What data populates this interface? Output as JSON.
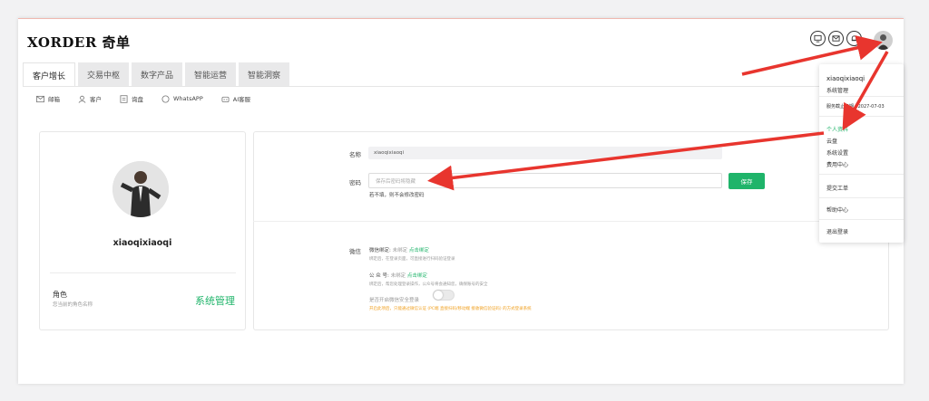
{
  "brand": {
    "logo_text": "XORDER 奇单"
  },
  "tabs": [
    {
      "label": "客户增长"
    },
    {
      "label": "交易中枢"
    },
    {
      "label": "数字产品"
    },
    {
      "label": "智能运营"
    },
    {
      "label": "智能洞察"
    }
  ],
  "toolbar": [
    {
      "label": "邮箱",
      "icon": "mail-icon"
    },
    {
      "label": "客户",
      "icon": "user-icon"
    },
    {
      "label": "询盘",
      "icon": "inquiry-icon"
    },
    {
      "label": "WhatsAPP",
      "icon": "chat-icon"
    },
    {
      "label": "AI客服",
      "icon": "robot-icon"
    }
  ],
  "header_icons": [
    "monitor-icon",
    "mail-icon",
    "bell-icon"
  ],
  "profile": {
    "username": "xiaoqixiaoqi",
    "role_label": "角色",
    "role_sub": "您当前的角色名称",
    "role_value": "系统管理"
  },
  "form": {
    "name_label": "名称",
    "name_value": "xiaoqixiaoqi",
    "password_label": "密码",
    "password_placeholder": "保存后密码将隐藏",
    "password_hint": "若不填，则不会修改密码",
    "save_label": "保存"
  },
  "wechat": {
    "section_label": "微信",
    "bind_label": "微信绑定:",
    "bind_status": "未绑定",
    "bind_action": "点击绑定",
    "bind_desc": "绑定后，在登录页面，可直接进行扫码验证登录",
    "official_label": "公 众 号:",
    "official_status": "未绑定",
    "official_action": "点击绑定",
    "official_desc": "绑定后，帮您处理登录操作，公众号将会通知您，确保账号的安全",
    "security_label": "是否开启微信安全登录",
    "security_warn": "开启此项后，只能通过微信认证 (PC端 直接扫码/移动端 接收微信验证码) 的方式登录系统"
  },
  "dropdown": {
    "username": "xiaoqixiaoqi",
    "role": "系统管理",
    "expiry_label": "服务截止日期",
    "expiry_date": "2027-07-03",
    "items": [
      "个人资料",
      "云盘",
      "系统设置",
      "费用中心"
    ],
    "ticket": "提交工单",
    "help": "帮助中心",
    "logout": "退出登录"
  },
  "colors": {
    "accent": "#1fb46a",
    "warning": "#f0a020",
    "arrow": "#e8352e"
  }
}
